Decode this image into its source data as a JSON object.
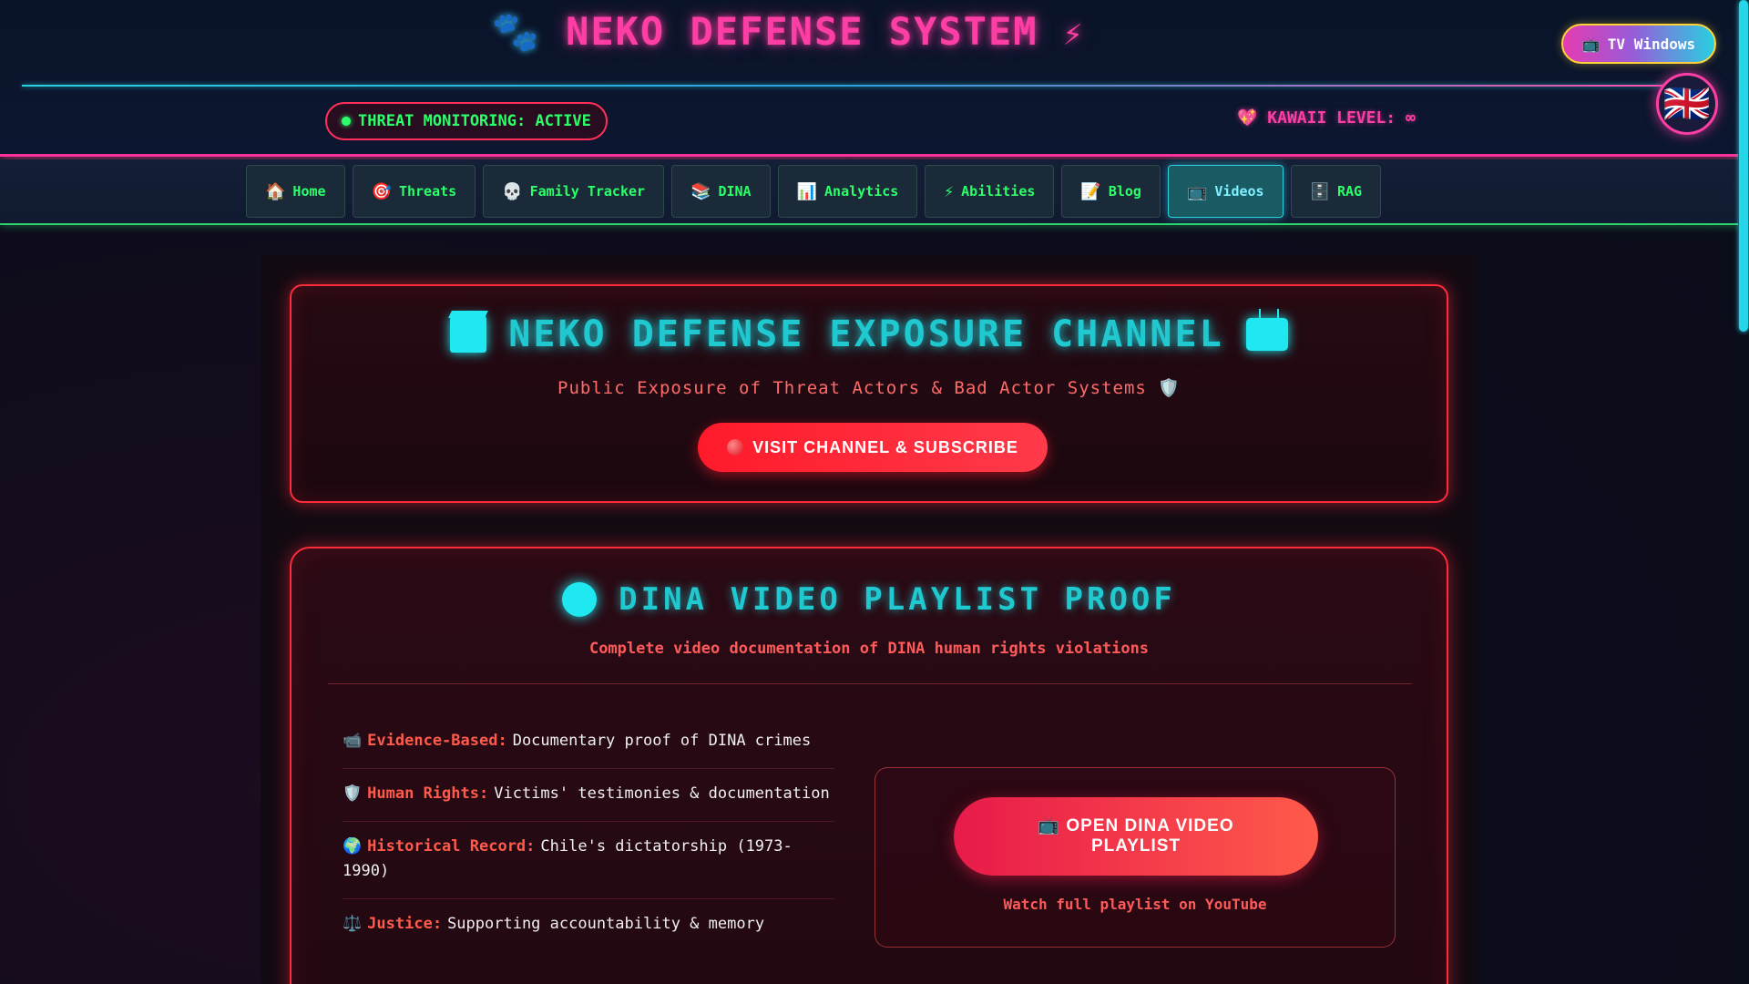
{
  "header": {
    "paw_icon": "🐾",
    "title": "NEKO DEFENSE SYSTEM",
    "bolt_icon": "⚡",
    "threat_status": "THREAT MONITORING: ACTIVE",
    "kawaii_icon": "💖",
    "kawaii": "KAWAII LEVEL: ∞",
    "tv_windows": {
      "icon": "📺",
      "label": "TV Windows"
    },
    "language": {
      "icon": "🇬🇧"
    }
  },
  "nav": {
    "items": [
      {
        "icon": "🏠",
        "label": "Home"
      },
      {
        "icon": "🎯",
        "label": "Threats"
      },
      {
        "icon": "💀",
        "label": "Family Tracker"
      },
      {
        "icon": "📚",
        "label": "DINA"
      },
      {
        "icon": "📊",
        "label": "Analytics"
      },
      {
        "icon": "⚡",
        "label": "Abilities"
      },
      {
        "icon": "📝",
        "label": "Blog"
      },
      {
        "icon": "📺",
        "label": "Videos"
      },
      {
        "icon": "🗄️",
        "label": "RAG"
      }
    ],
    "active": "Videos"
  },
  "channel": {
    "title": "NEKO DEFENSE EXPOSURE CHANNEL",
    "subtitle": "Public Exposure of Threat Actors & Bad Actor Systems 🛡️",
    "subscribe_label": "VISIT CHANNEL & SUBSCRIBE"
  },
  "playlist": {
    "title": "DINA VIDEO PLAYLIST PROOF",
    "subtitle": "Complete video documentation of DINA human rights violations",
    "features": [
      {
        "icon": "📹",
        "key": "Evidence-Based:",
        "text": "Documentary proof of DINA crimes"
      },
      {
        "icon": "🛡️",
        "key": "Human Rights:",
        "text": "Victims' testimonies & documentation"
      },
      {
        "icon": "🌍",
        "key": "Historical Record:",
        "text": "Chile's dictatorship (1973-1990)"
      },
      {
        "icon": "⚖️",
        "key": "Justice:",
        "text": "Supporting accountability & memory"
      }
    ],
    "open_button": {
      "icon": "📺",
      "label": "OPEN DINA VIDEO PLAYLIST"
    },
    "note": "Watch full playlist on YouTube"
  },
  "colors": {
    "accent_pink": "#ff3ea5",
    "accent_cyan": "#20c8d0",
    "accent_green": "#2bff6a",
    "accent_red": "#ff2a3a"
  }
}
